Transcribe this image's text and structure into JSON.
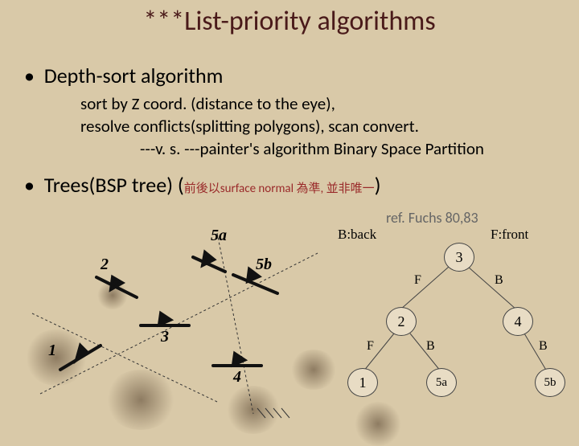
{
  "title": "***List-priority algorithms",
  "bullets": {
    "b1": "Depth-sort algorithm",
    "b1_sub1": "sort by Z coord. (distance to the eye),",
    "b1_sub2": "resolve conflicts(splitting polygons), scan convert.",
    "b1_sub3": "---v. s. ---painter's algorithm  Binary Space Partition",
    "b2_pre": "Trees(BSP tree) (",
    "b2_note": "前後以surface normal 為準, 並非唯一",
    "b2_post": ")"
  },
  "ref": "ref. Fuchs 80,83",
  "tree": {
    "b_label": "B:back",
    "f_label": "F:front"
  },
  "diag": {
    "n1": "1",
    "n2": "2",
    "n3": "3",
    "n4": "4",
    "n5a": "5a",
    "n5b": "5b"
  },
  "nodes": {
    "r": "3",
    "l1": "2",
    "r1": "4",
    "ll": "1",
    "lr": "5a",
    "rr": "5b"
  },
  "edges": {
    "f": "F",
    "b": "B"
  }
}
